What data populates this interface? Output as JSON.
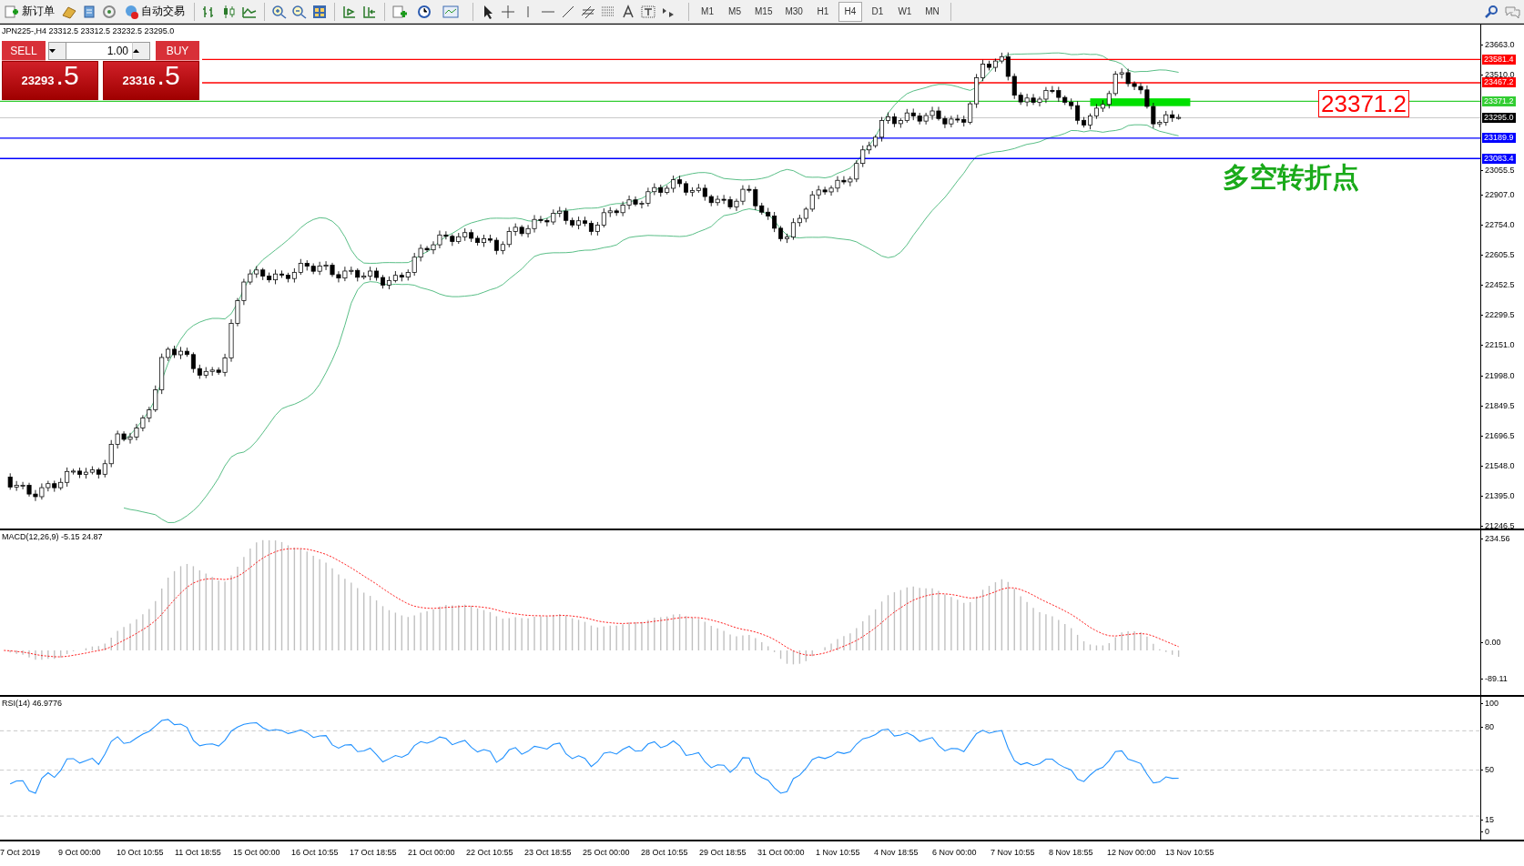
{
  "toolbar": {
    "new_order": "新订单",
    "auto_trading": "自动交易",
    "timeframes": [
      {
        "label": "M1",
        "selected": false
      },
      {
        "label": "M5",
        "selected": false
      },
      {
        "label": "M15",
        "selected": false
      },
      {
        "label": "M30",
        "selected": false
      },
      {
        "label": "H1",
        "selected": false
      },
      {
        "label": "H4",
        "selected": true
      },
      {
        "label": "D1",
        "selected": false
      },
      {
        "label": "W1",
        "selected": false
      },
      {
        "label": "MN",
        "selected": false
      }
    ]
  },
  "chart": {
    "header": "JPN225-,H4  23312.5 23312.5 23232.5 23295.0",
    "trade_panel": {
      "sell_label": "SELL",
      "buy_label": "BUY",
      "lot": "1.00",
      "sell_price": "23293",
      "sell_pips": ".5",
      "buy_price": "23316",
      "buy_pips": ".5"
    },
    "price_ticks": [
      "23663.0",
      "23510.0",
      "23055.5",
      "22907.0",
      "22754.0",
      "22605.5",
      "22452.5",
      "22299.5",
      "22151.0",
      "21998.0",
      "21849.5",
      "21696.5",
      "21548.0",
      "21395.0",
      "21246.5"
    ],
    "price_lines": [
      {
        "label": "23581.4",
        "color": "#ff0000"
      },
      {
        "label": "23467.2",
        "color": "#ff0000"
      },
      {
        "label": "23371.2",
        "color": "#32cd32"
      },
      {
        "label": "23295.0",
        "color": "#000000"
      },
      {
        "label": "23189.9",
        "color": "#0000ff"
      },
      {
        "label": "23083.4",
        "color": "#0000ff"
      }
    ],
    "callout_price": "23371.2",
    "callout_text": "多空转折点"
  },
  "macd": {
    "label": "MACD(12,26,9) -5.15 24.87",
    "ticks": [
      "234.56",
      "0.00",
      "-89.11"
    ]
  },
  "rsi": {
    "label": "RSI(14) 46.9776",
    "ticks": [
      "100",
      "80",
      "50",
      "15",
      "0"
    ]
  },
  "time_axis": [
    "7 Oct 2019",
    "9 Oct 00:00",
    "10 Oct 10:55",
    "11 Oct 18:55",
    "15 Oct 00:00",
    "16 Oct 10:55",
    "17 Oct 18:55",
    "21 Oct 00:00",
    "22 Oct 10:55",
    "23 Oct 18:55",
    "25 Oct 00:00",
    "28 Oct 10:55",
    "29 Oct 18:55",
    "31 Oct 00:00",
    "1 Nov 10:55",
    "4 Nov 18:55",
    "6 Nov 00:00",
    "7 Nov 10:55",
    "8 Nov 18:55",
    "12 Nov 00:00",
    "13 Nov 10:55"
  ]
}
